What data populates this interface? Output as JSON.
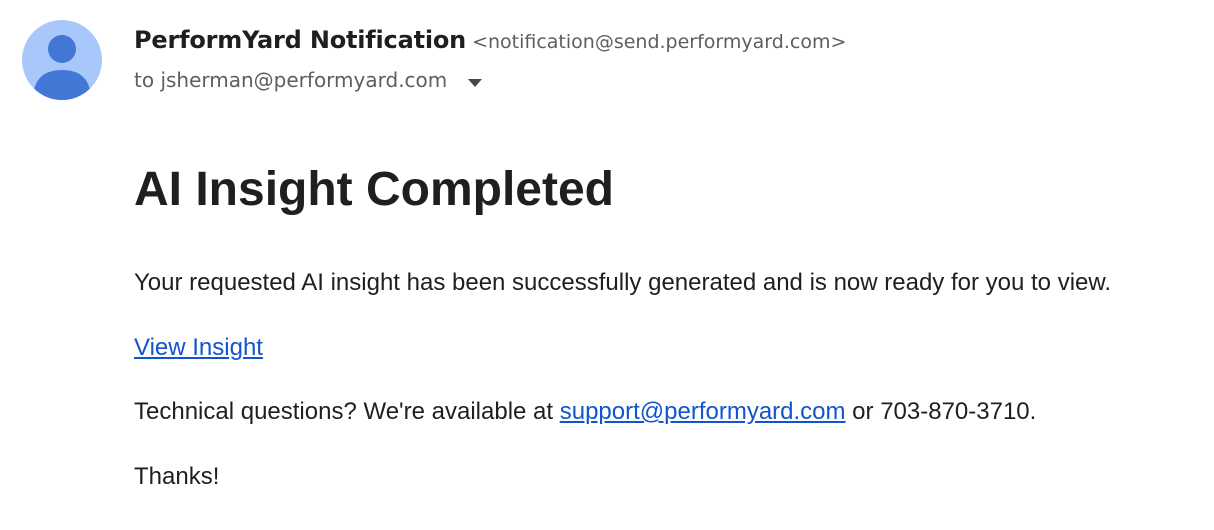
{
  "email": {
    "sender": {
      "name": "PerformYard Notification",
      "address": "<notification@send.performyard.com>"
    },
    "recipient": {
      "prefix": "to",
      "address": "jsherman@performyard.com"
    },
    "avatar_icon": "person-icon",
    "toggle_icon": "caret-down-icon"
  },
  "message": {
    "title": "AI Insight Completed",
    "intro": "Your requested AI insight has been successfully generated and is now ready for you to view.",
    "cta_link": "View Insight",
    "support": {
      "before": "Technical questions? We're available at ",
      "email_link": "support@performyard.com",
      "after": " or 703-870-3710."
    },
    "closing": "Thanks!"
  },
  "colors": {
    "avatar_background": "#a8c7fa",
    "avatar_figure": "#4377d6",
    "link": "#1155cc",
    "text": "#1f1f1f",
    "secondary_text": "#5e5e5e"
  }
}
